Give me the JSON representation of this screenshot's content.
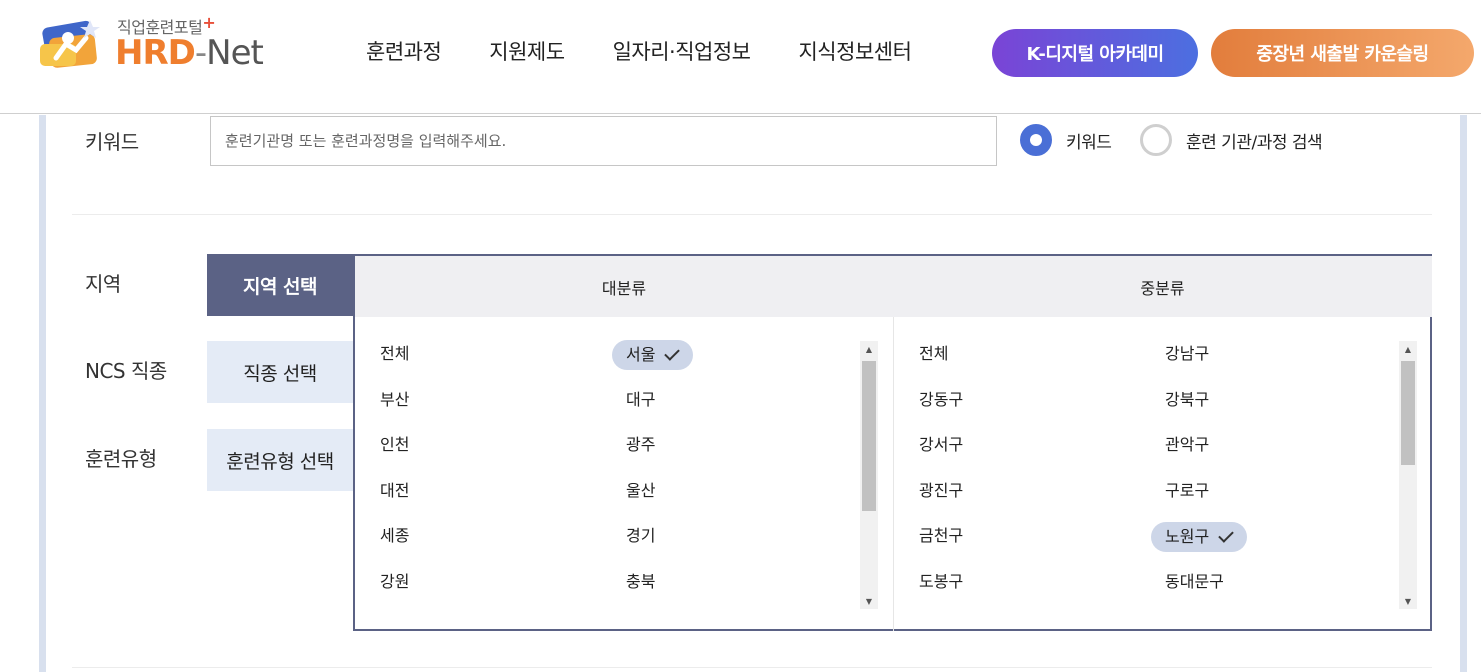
{
  "header": {
    "logo": {
      "subtitle": "직업훈련포털",
      "plus": "+",
      "brand_hrd": "HRD",
      "brand_dash": "-",
      "brand_net": "Net"
    },
    "nav": [
      "훈련과정",
      "지원제도",
      "일자리·직업정보",
      "지식정보센터"
    ],
    "buttons": {
      "kdigital": "K-디지털 아카데미",
      "midlife": "중장년 새출발 카운슬링"
    }
  },
  "search": {
    "keyword_label": "키워드",
    "keyword_placeholder": "훈련기관명 또는 훈련과정명을 입력해주세요.",
    "radio_options": [
      {
        "label": "키워드",
        "selected": true
      },
      {
        "label": "훈련 기관/과정 검색",
        "selected": false
      }
    ]
  },
  "filters": {
    "region_label": "지역",
    "ncs_label": "NCS 직종",
    "type_label": "훈련유형",
    "region_button": "지역 선택",
    "ncs_button": "직종 선택",
    "type_button": "훈련유형 선택"
  },
  "region_panel": {
    "major_header": "대분류",
    "middle_header": "중분류",
    "major_items": [
      "전체",
      "서울",
      "부산",
      "대구",
      "인천",
      "광주",
      "대전",
      "울산",
      "세종",
      "경기",
      "강원",
      "충북"
    ],
    "major_selected": "서울",
    "middle_items": [
      "전체",
      "강남구",
      "강동구",
      "강북구",
      "강서구",
      "관악구",
      "광진구",
      "구로구",
      "금천구",
      "노원구",
      "도봉구",
      "동대문구"
    ],
    "middle_selected": "노원구"
  },
  "colors": {
    "accent_blue": "#4a6fd6",
    "tab_active": "#5b6285",
    "tab_inactive": "#e4ebf6",
    "selected_chip": "#cdd6e8",
    "brand_orange": "#ef7e2e"
  }
}
